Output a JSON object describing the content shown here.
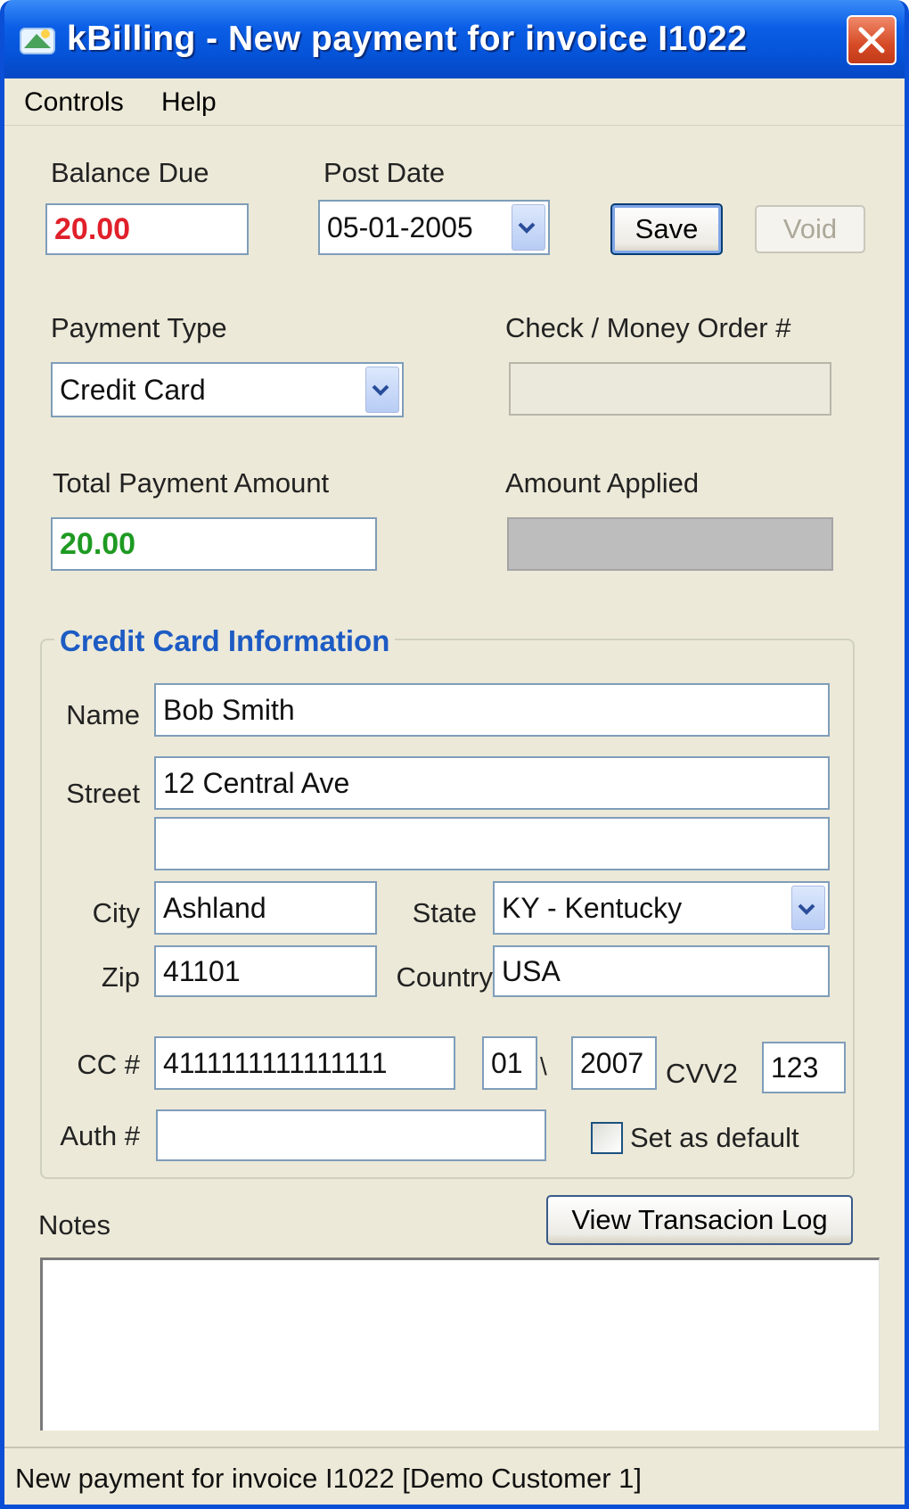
{
  "window": {
    "title": "kBilling - New payment for invoice I1022"
  },
  "menu": {
    "items": [
      "Controls",
      "Help"
    ]
  },
  "form": {
    "balance_due_label": "Balance Due",
    "balance_due_value": "20.00",
    "post_date_label": "Post Date",
    "post_date_value": "05-01-2005",
    "save_label": "Save",
    "void_label": "Void",
    "payment_type_label": "Payment Type",
    "payment_type_value": "Credit Card",
    "check_label": "Check / Money Order #",
    "check_value": "",
    "total_payment_label": "Total Payment Amount",
    "total_payment_value": "20.00",
    "amount_applied_label": "Amount Applied",
    "amount_applied_value": ""
  },
  "credit_card": {
    "group_title": "Credit Card Information",
    "name_label": "Name",
    "name_value": "Bob Smith",
    "street_label": "Street",
    "street1_value": "12 Central Ave",
    "street2_value": "",
    "city_label": "City",
    "city_value": "Ashland",
    "state_label": "State",
    "state_value": "KY - Kentucky",
    "zip_label": "Zip",
    "zip_value": "41101",
    "country_label": "Country",
    "country_value": "USA",
    "cc_label": "CC #",
    "cc_value": "4111111111111111",
    "exp_month_value": "01",
    "exp_separator": "\\",
    "exp_year_value": "2007",
    "cvv_label": "CVV2",
    "cvv_value": "123",
    "auth_label": "Auth #",
    "auth_value": "",
    "default_checkbox_label": "Set as default",
    "default_checked": false
  },
  "notes": {
    "label": "Notes",
    "view_log_label": "View Transacion Log",
    "value": ""
  },
  "status": {
    "text": "New payment for invoice I1022 [Demo Customer 1]"
  },
  "colors": {
    "balance_due": "#e0202a",
    "total_payment": "#1e9a22",
    "group_title": "#1d5bc4",
    "titlebar": "#0553d8"
  },
  "icons": {
    "app": "kbilling-app-icon",
    "close": "close-icon",
    "dropdown": "chevron-down-icon"
  }
}
